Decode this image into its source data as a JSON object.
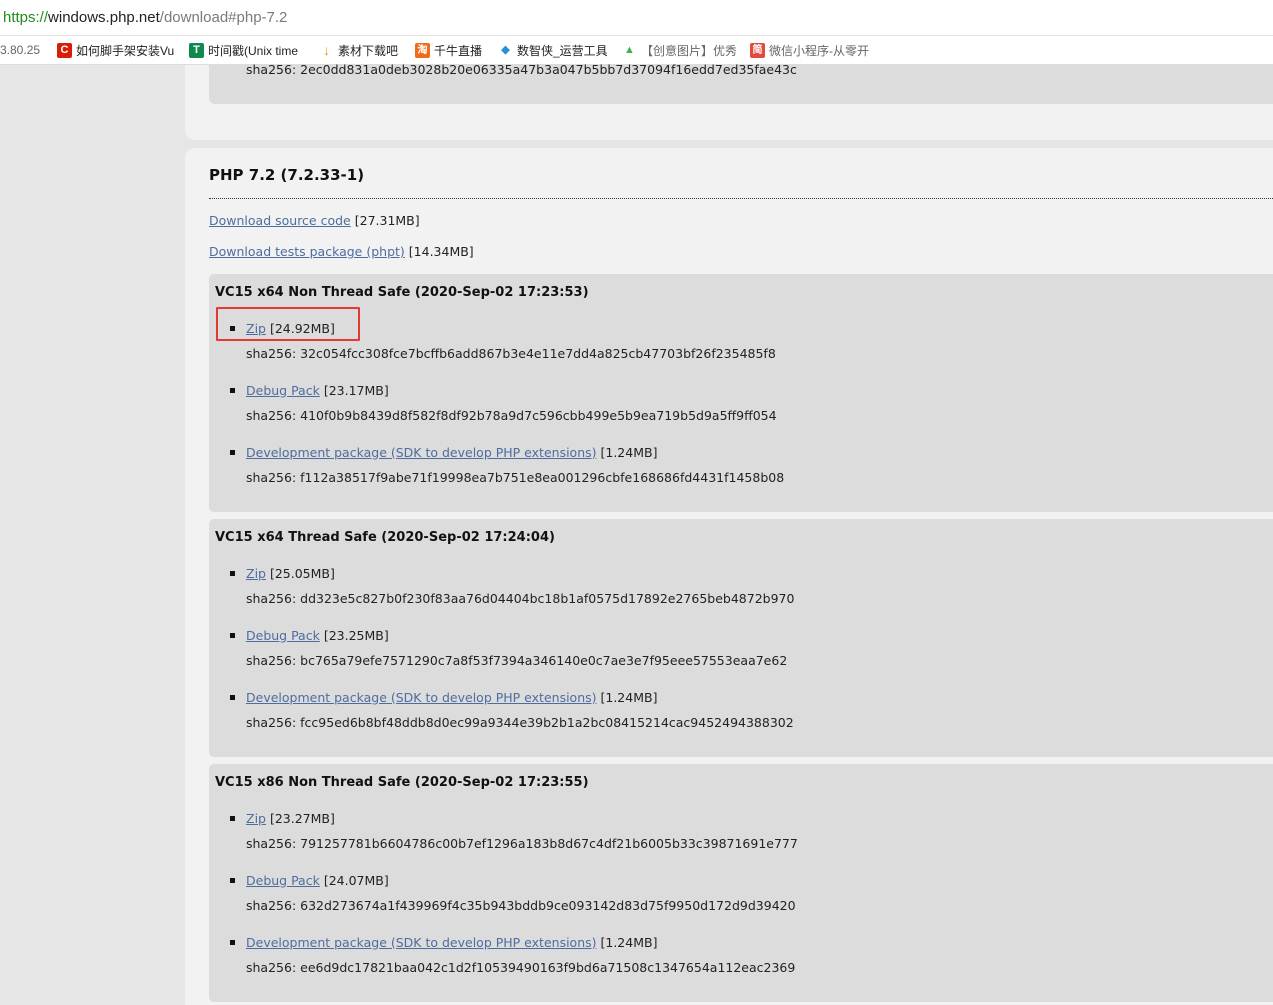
{
  "address_bar": {
    "scheme": "https://",
    "host": "windows.php.net",
    "path": "/download#php-7.2"
  },
  "bookmarks": [
    {
      "label": "3.80.25",
      "icon": "none",
      "color": ""
    },
    {
      "label": "如何脚手架安装Vu",
      "icon": "c-logo-icon",
      "color": "#d81e06",
      "glyph": "C"
    },
    {
      "label": "时间戳(Unix time",
      "icon": "t-logo-icon",
      "color": "#0e8a4f",
      "glyph": "T"
    },
    {
      "label": "素材下载吧",
      "icon": "download-icon",
      "color": "#e8a317",
      "glyph": "↓"
    },
    {
      "label": "千牛直播",
      "icon": "qianniu-icon",
      "color": "#f26b1d",
      "glyph": "淘"
    },
    {
      "label": "数智侠_运营工具",
      "icon": "shield-icon",
      "color": "#2a8fd6",
      "glyph": "◆"
    },
    {
      "label": "【创意图片】优秀",
      "icon": "leaf-icon",
      "color": "#3fb34f",
      "glyph": "▲"
    },
    {
      "label": "微信小程序-从零开",
      "icon": "jian-icon",
      "color": "#e04b3c",
      "glyph": "简"
    }
  ],
  "prev_section": {
    "hash": "sha256: 2ec0dd831a0deb3028b20e06335a47b3a047b5bb7d37094f16edd7ed35fae43c"
  },
  "version": {
    "title": "PHP 7.2 (7.2.33-1)",
    "source_link": "Download source code",
    "source_size": "[27.31MB]",
    "tests_link": "Download tests package (phpt)",
    "tests_size": "[14.34MB]"
  },
  "builds": [
    {
      "title": "VC15 x64 Non Thread Safe (2020-Sep-02 17:23:53)",
      "packages": [
        {
          "link": "Zip",
          "size": "[24.92MB]",
          "hash": "sha256: 32c054fcc308fce7bcffb6add867b3e4e11e7dd4a825cb47703bf26f235485f8"
        },
        {
          "link": "Debug Pack",
          "size": "[23.17MB]",
          "hash": "sha256: 410f0b9b8439d8f582f8df92b78a9d7c596cbb499e5b9ea719b5d9a5ff9ff054"
        },
        {
          "link": "Development package (SDK to develop PHP extensions)",
          "size": "[1.24MB]",
          "hash": "sha256: f112a38517f9abe71f19998ea7b751e8ea001296cbfe168686fd4431f1458b08"
        }
      ]
    },
    {
      "title": "VC15 x64 Thread Safe (2020-Sep-02 17:24:04)",
      "packages": [
        {
          "link": "Zip",
          "size": "[25.05MB]",
          "hash": "sha256: dd323e5c827b0f230f83aa76d04404bc18b1af0575d17892e2765beb4872b970"
        },
        {
          "link": "Debug Pack",
          "size": "[23.25MB]",
          "hash": "sha256: bc765a79efe7571290c7a8f53f7394a346140e0c7ae3e7f95eee57553eaa7e62"
        },
        {
          "link": "Development package (SDK to develop PHP extensions)",
          "size": "[1.24MB]",
          "hash": "sha256: fcc95ed6b8bf48ddb8d0ec99a9344e39b2b1a2bc08415214cac9452494388302"
        }
      ]
    },
    {
      "title": "VC15 x86 Non Thread Safe (2020-Sep-02 17:23:55)",
      "packages": [
        {
          "link": "Zip",
          "size": "[23.27MB]",
          "hash": "sha256: 791257781b6604786c00b7ef1296a183b8d67c4df21b6005b33c39871691e777"
        },
        {
          "link": "Debug Pack",
          "size": "[24.07MB]",
          "hash": "sha256: 632d273674a1f439969f4c35b943bddb9ce093142d83d75f9950d172d9d39420"
        },
        {
          "link": "Development package (SDK to develop PHP extensions)",
          "size": "[1.24MB]",
          "hash": "sha256: ee6d9dc17821baa042c1d2f10539490163f9bd6a71508c1347654a112eac2369"
        }
      ]
    }
  ],
  "colors": {
    "link": "#4e6d9f",
    "highlight_box": "#e53935",
    "scheme": "#1f8f1f"
  }
}
